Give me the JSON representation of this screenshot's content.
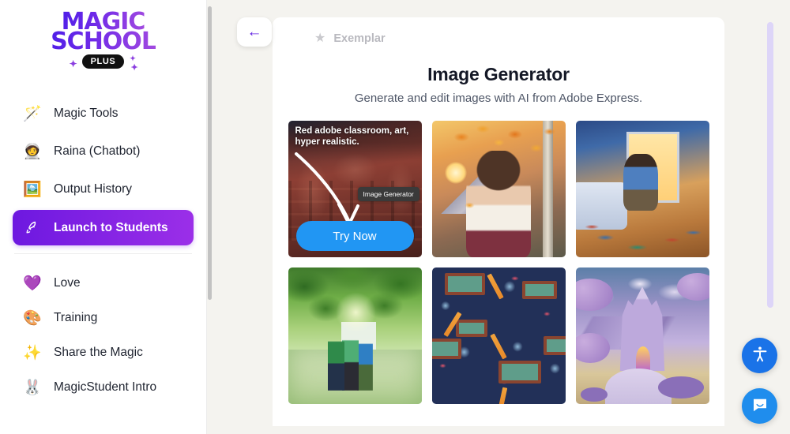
{
  "brand": {
    "logo_line1": "MAGIC",
    "logo_line2": "SCHOOL",
    "plus_badge": "PLUS",
    "accent_purple": "#6d18e0",
    "accent_magenta": "#9b2fe8"
  },
  "sidebar": {
    "primary_items": [
      {
        "label": "Magic Tools",
        "icon": "magic-wand-icon",
        "glyph": "🪄",
        "active": false
      },
      {
        "label": "Raina (Chatbot)",
        "icon": "chatbot-avatar-icon",
        "glyph": "🧑‍🚀",
        "active": false
      },
      {
        "label": "Output History",
        "icon": "history-icon",
        "glyph": "🖼️",
        "active": false
      },
      {
        "label": "Launch to Students",
        "icon": "rocket-icon",
        "glyph": "🚀",
        "active": true
      }
    ],
    "secondary_items": [
      {
        "label": "Love",
        "icon": "heart-icon",
        "glyph": "💜"
      },
      {
        "label": "Training",
        "icon": "easel-icon",
        "glyph": "🎨"
      },
      {
        "label": "Share the Magic",
        "icon": "sparkles-icon",
        "glyph": "✨"
      },
      {
        "label": "MagicStudent Intro",
        "icon": "rabbit-icon",
        "glyph": "🐰"
      }
    ]
  },
  "main": {
    "back_button_icon": "back-arrow-icon",
    "back_button_glyph": "←",
    "exemplar_label": "Exemplar",
    "star_icon": "star-icon",
    "star_glyph": "★",
    "title": "Image Generator",
    "subtitle": "Generate and edit images with AI from Adobe Express.",
    "cards": [
      {
        "name": "red-adobe-classroom",
        "prompt_text": "Red adobe classroom, art, hyper realistic.",
        "tooltip": "Image Generator",
        "cta_label": "Try Now",
        "cta_color": "#2196f3"
      },
      {
        "name": "autumn-portrait-woman",
        "prompt_text": "",
        "tooltip": "",
        "cta_label": ""
      },
      {
        "name": "boy-jumping-bedroom",
        "prompt_text": "",
        "tooltip": "",
        "cta_label": ""
      },
      {
        "name": "students-walking-path",
        "prompt_text": "",
        "tooltip": "",
        "cta_label": ""
      },
      {
        "name": "school-supplies-pattern",
        "prompt_text": "",
        "tooltip": "",
        "cta_label": ""
      },
      {
        "name": "purple-castle-school",
        "prompt_text": "",
        "tooltip": "",
        "cta_label": ""
      }
    ]
  },
  "floating": {
    "accessibility_icon": "accessibility-icon",
    "accessibility_color": "#1a73e8",
    "chat_icon": "chat-bubble-icon",
    "chat_color": "#1f8ded"
  }
}
